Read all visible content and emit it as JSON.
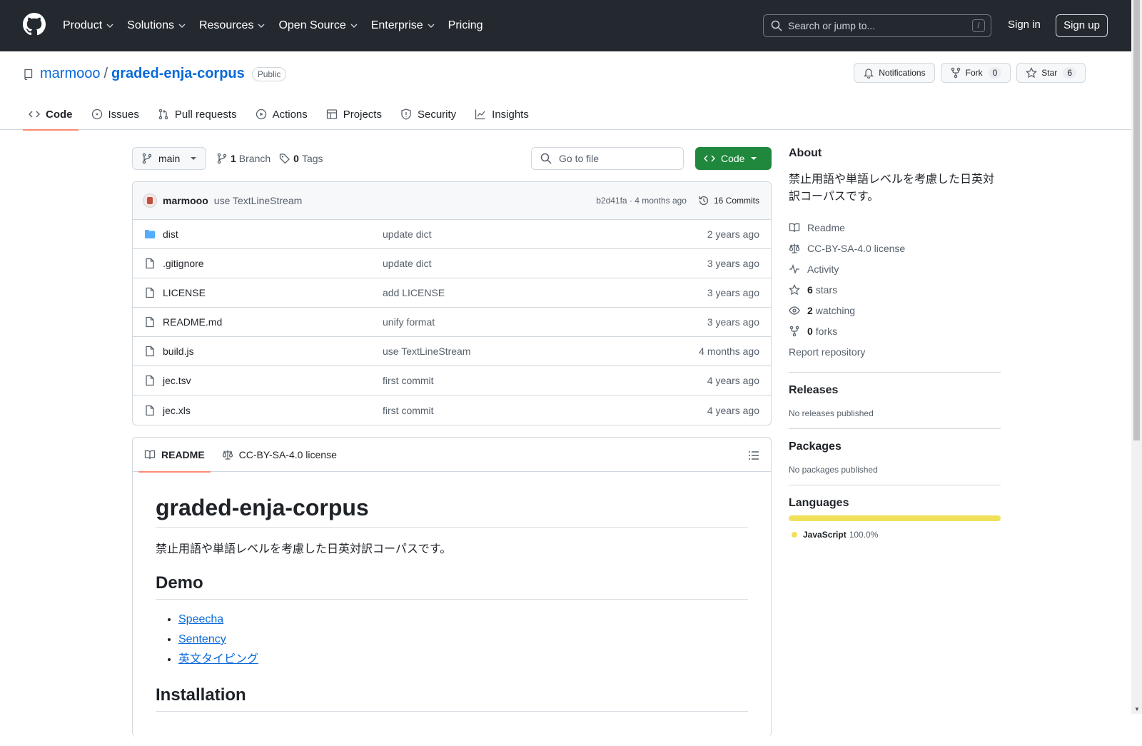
{
  "header": {
    "nav": [
      {
        "label": "Product",
        "has_menu": true
      },
      {
        "label": "Solutions",
        "has_menu": true
      },
      {
        "label": "Resources",
        "has_menu": true
      },
      {
        "label": "Open Source",
        "has_menu": true
      },
      {
        "label": "Enterprise",
        "has_menu": true
      },
      {
        "label": "Pricing",
        "has_menu": false
      }
    ],
    "search_placeholder": "Search or jump to...",
    "search_key": "/",
    "sign_in": "Sign in",
    "sign_up": "Sign up"
  },
  "repo": {
    "owner": "marmooo",
    "separator": "/",
    "name": "graded-enja-corpus",
    "visibility": "Public",
    "notifications_label": "Notifications",
    "fork_label": "Fork",
    "fork_count": "0",
    "star_label": "Star",
    "star_count": "6"
  },
  "tabs": [
    {
      "label": "Code",
      "icon": "code-icon",
      "active": true
    },
    {
      "label": "Issues",
      "icon": "issue-icon"
    },
    {
      "label": "Pull requests",
      "icon": "pull-request-icon"
    },
    {
      "label": "Actions",
      "icon": "play-icon"
    },
    {
      "label": "Projects",
      "icon": "table-icon"
    },
    {
      "label": "Security",
      "icon": "shield-icon"
    },
    {
      "label": "Insights",
      "icon": "graph-icon"
    }
  ],
  "toolbar": {
    "branch": "main",
    "branch_count": "1",
    "branch_label": "Branch",
    "tag_count": "0",
    "tag_label": "Tags",
    "goto_placeholder": "Go to file",
    "code_label": "Code"
  },
  "commit": {
    "author": "marmooo",
    "message": "use TextLineStream",
    "hash_time": "b2d41fa · 4 months ago",
    "commits_label": "16 Commits"
  },
  "files": [
    {
      "name": "dist",
      "type": "dir",
      "message": "update dict",
      "date": "2 years ago"
    },
    {
      "name": ".gitignore",
      "type": "file",
      "message": "update dict",
      "date": "3 years ago"
    },
    {
      "name": "LICENSE",
      "type": "file",
      "message": "add LICENSE",
      "date": "3 years ago"
    },
    {
      "name": "README.md",
      "type": "file",
      "message": "unify format",
      "date": "3 years ago"
    },
    {
      "name": "build.js",
      "type": "file",
      "message": "use TextLineStream",
      "date": "4 months ago"
    },
    {
      "name": "jec.tsv",
      "type": "file",
      "message": "first commit",
      "date": "4 years ago"
    },
    {
      "name": "jec.xls",
      "type": "file",
      "message": "first commit",
      "date": "4 years ago"
    }
  ],
  "readme": {
    "tab_readme": "README",
    "tab_license": "CC-BY-SA-4.0 license",
    "h1": "graded-enja-corpus",
    "intro": "禁止用語や単語レベルを考慮した日英対訳コーパスです。",
    "demo_heading": "Demo",
    "demo_links": [
      "Speecha",
      "Sentency",
      "英文タイピング"
    ],
    "install_heading": "Installation"
  },
  "about": {
    "heading": "About",
    "description": "禁止用語や単語レベルを考慮した日英対訳コーパスです。",
    "readme": "Readme",
    "license": "CC-BY-SA-4.0 license",
    "activity": "Activity",
    "stars_count": "6",
    "stars_label": "stars",
    "watching_count": "2",
    "watching_label": "watching",
    "forks_count": "0",
    "forks_label": "forks",
    "report": "Report repository"
  },
  "releases": {
    "heading": "Releases",
    "text": "No releases published"
  },
  "packages": {
    "heading": "Packages",
    "text": "No packages published"
  },
  "languages": {
    "heading": "Languages",
    "items": [
      {
        "name": "JavaScript",
        "percent": "100.0%",
        "color": "#f1e05a"
      }
    ]
  }
}
